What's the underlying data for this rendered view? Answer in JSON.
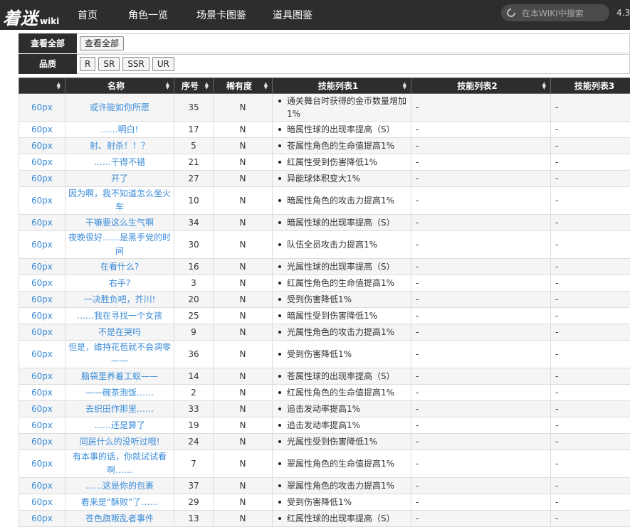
{
  "header": {
    "logo_main": "着迷",
    "logo_sub": "wiki",
    "nav": [
      "首页",
      "角色一览",
      "场景卡图鉴",
      "道具图鉴"
    ],
    "search_placeholder": "在本WIKI中搜索",
    "version": "4.3"
  },
  "filters": {
    "all_label": "查看全部",
    "all_button": "查看全部",
    "quality_label": "品质",
    "quality_options": [
      "R",
      "SR",
      "SSR",
      "UR"
    ]
  },
  "table": {
    "columns": [
      "",
      "名称",
      "序号",
      "稀有度",
      "技能列表1",
      "技能列表2",
      "技能列表3"
    ],
    "rows": [
      {
        "size": "60px",
        "name": "或许能如你所愿",
        "num": "35",
        "rarity": "N",
        "skill1": "通关舞台时获得的金币数量增加1%",
        "skill2": "-",
        "skill3": "-"
      },
      {
        "size": "60px",
        "name": "……明白!",
        "num": "17",
        "rarity": "N",
        "skill1": "暗属性球的出现率提高（S）",
        "skill2": "-",
        "skill3": "-"
      },
      {
        "size": "60px",
        "name": "射、射杀！！？",
        "num": "5",
        "rarity": "N",
        "skill1": "苍属性角色的生命值提高1%",
        "skill2": "-",
        "skill3": "-"
      },
      {
        "size": "60px",
        "name": "……干得不错",
        "num": "21",
        "rarity": "N",
        "skill1": "红属性受到伤害降低1%",
        "skill2": "-",
        "skill3": "-"
      },
      {
        "size": "60px",
        "name": "开了",
        "num": "27",
        "rarity": "N",
        "skill1": "异能球体积变大1%",
        "skill2": "-",
        "skill3": "-"
      },
      {
        "size": "60px",
        "name": "因为啊，我不知道怎么坐火车",
        "num": "10",
        "rarity": "N",
        "skill1": "暗属性角色的攻击力提高1%",
        "skill2": "-",
        "skill3": "-"
      },
      {
        "size": "60px",
        "name": "干嘛要这么生气啊",
        "num": "34",
        "rarity": "N",
        "skill1": "暗属性球的出现率提高（S）",
        "skill2": "-",
        "skill3": "-"
      },
      {
        "size": "60px",
        "name": "夜晚很好……是黑手党的时间",
        "num": "30",
        "rarity": "N",
        "skill1": "队伍全员攻击力提高1%",
        "skill2": "-",
        "skill3": "-"
      },
      {
        "size": "60px",
        "name": "在看什么?",
        "num": "16",
        "rarity": "N",
        "skill1": "光属性球的出现率提高（S）",
        "skill2": "-",
        "skill3": "-"
      },
      {
        "size": "60px",
        "name": "右手?",
        "num": "3",
        "rarity": "N",
        "skill1": "红属性角色的生命值提高1%",
        "skill2": "-",
        "skill3": "-"
      },
      {
        "size": "60px",
        "name": "一决胜负吧，芥川!",
        "num": "20",
        "rarity": "N",
        "skill1": "受到伤害降低1%",
        "skill2": "-",
        "skill3": "-"
      },
      {
        "size": "60px",
        "name": "……我在寻找一个女孩",
        "num": "25",
        "rarity": "N",
        "skill1": "暗属性受到伤害降低1%",
        "skill2": "-",
        "skill3": "-"
      },
      {
        "size": "60px",
        "name": "不是在哭吗",
        "num": "9",
        "rarity": "N",
        "skill1": "光属性角色的攻击力提高1%",
        "skill2": "-",
        "skill3": "-"
      },
      {
        "size": "60px",
        "name": "但是，维持花苞就不会凋零——",
        "num": "36",
        "rarity": "N",
        "skill1": "受到伤害降低1%",
        "skill2": "-",
        "skill3": "-"
      },
      {
        "size": "60px",
        "name": "脑袋里养着工蚁——",
        "num": "14",
        "rarity": "N",
        "skill1": "苍属性球的出现率提高（S）",
        "skill2": "-",
        "skill3": "-"
      },
      {
        "size": "60px",
        "name": "——碗茶泡饭……",
        "num": "2",
        "rarity": "N",
        "skill1": "红属性角色的生命值提高1%",
        "skill2": "-",
        "skill3": "-"
      },
      {
        "size": "60px",
        "name": "去织田作那里……",
        "num": "33",
        "rarity": "N",
        "skill1": "追击发动率提高1%",
        "skill2": "-",
        "skill3": "-"
      },
      {
        "size": "60px",
        "name": "……还是算了",
        "num": "19",
        "rarity": "N",
        "skill1": "追击发动率提高1%",
        "skill2": "-",
        "skill3": "-"
      },
      {
        "size": "60px",
        "name": "同居什么的没听过哦!",
        "num": "24",
        "rarity": "N",
        "skill1": "光属性受到伤害降低1%",
        "skill2": "-",
        "skill3": "-"
      },
      {
        "size": "60px",
        "name": "有本事的话，你就试试看啊……",
        "num": "7",
        "rarity": "N",
        "skill1": "翠属性角色的生命值提高1%",
        "skill2": "-",
        "skill3": "-"
      },
      {
        "size": "60px",
        "name": "……这是你的包裹",
        "num": "37",
        "rarity": "N",
        "skill1": "翠属性角色的攻击力提高1%",
        "skill2": "-",
        "skill3": "-"
      },
      {
        "size": "60px",
        "name": "看来是“酥败”了……",
        "num": "29",
        "rarity": "N",
        "skill1": "受到伤害降低1%",
        "skill2": "-",
        "skill3": "-"
      },
      {
        "size": "60px",
        "name": "苍色旗叛乱者事件",
        "num": "13",
        "rarity": "N",
        "skill1": "红属性球的出现率提高（S）",
        "skill2": "-",
        "skill3": "-"
      }
    ]
  }
}
